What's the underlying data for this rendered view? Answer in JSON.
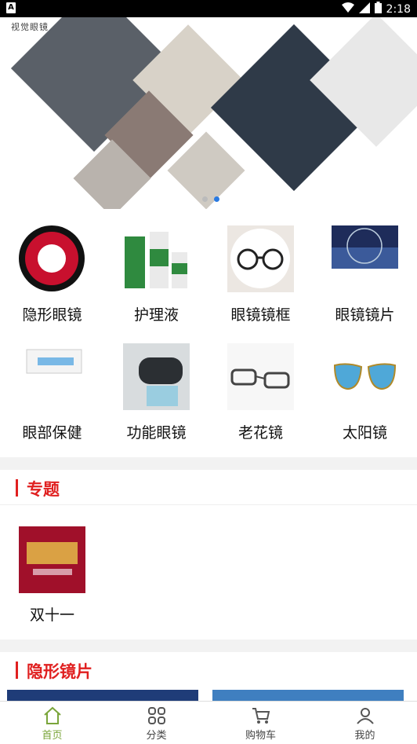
{
  "status_bar": {
    "time": "2:18",
    "left_icon": "A"
  },
  "banner": {
    "brand_text": "视觉眼镜"
  },
  "categories": [
    {
      "label": "隐形眼镜",
      "icon": "contact-lens-icon"
    },
    {
      "label": "护理液",
      "icon": "care-solution-icon"
    },
    {
      "label": "眼镜镜框",
      "icon": "glasses-frame-icon"
    },
    {
      "label": "眼镜镜片",
      "icon": "lens-icon"
    },
    {
      "label": "眼部保健",
      "icon": "eye-care-icon"
    },
    {
      "label": "功能眼镜",
      "icon": "functional-glasses-icon"
    },
    {
      "label": "老花镜",
      "icon": "reading-glasses-icon"
    },
    {
      "label": "太阳镜",
      "icon": "sunglasses-icon"
    }
  ],
  "topics": {
    "title": "专题",
    "items": [
      {
        "label": "双十一"
      }
    ]
  },
  "contact_section": {
    "title": "隐形镜片"
  },
  "bottom_nav": [
    {
      "label": "首页",
      "icon": "home-icon",
      "active": true
    },
    {
      "label": "分类",
      "icon": "category-grid-icon",
      "active": false
    },
    {
      "label": "购物车",
      "icon": "cart-icon",
      "active": false
    },
    {
      "label": "我的",
      "icon": "user-icon",
      "active": false
    }
  ],
  "colors": {
    "accent": "#e02020",
    "nav_active": "#7aa53a",
    "page_bg": "#f2f2f2"
  }
}
